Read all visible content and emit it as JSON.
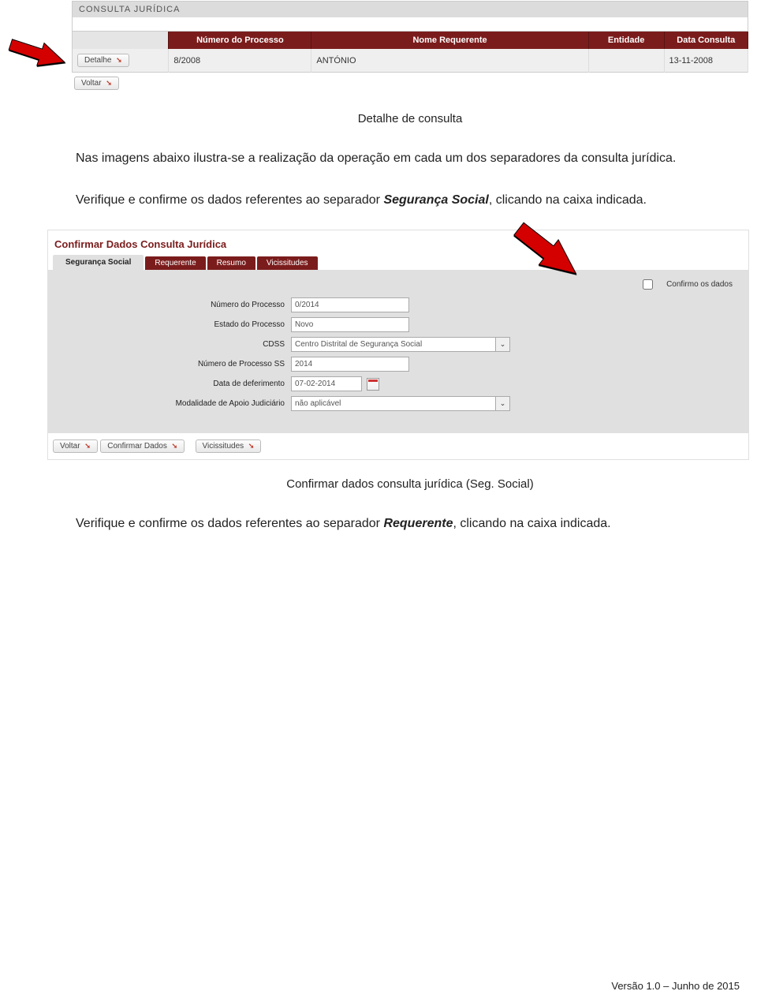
{
  "screenshot1": {
    "panel_title": "CONSULTA JURÍDICA",
    "columns": {
      "processo": "Número do Processo",
      "nome": "Nome Requerente",
      "entidade": "Entidade",
      "data": "Data Consulta"
    },
    "row": {
      "detalhe_btn": "Detalhe",
      "processo": "8/2008",
      "nome": "ANTÓNIO",
      "entidade": "",
      "data": "13-11-2008"
    },
    "voltar_btn": "Voltar"
  },
  "caption1": "Detalhe de consulta",
  "para1_a": "Nas imagens abaixo ilustra-se a realização da operação em cada um dos separadores da consulta jurídica.",
  "para2_a": "Verifique e confirme os dados referentes ao separador ",
  "para2_em": "Segurança Social",
  "para2_b": ", clicando na caixa indicada.",
  "screenshot2": {
    "heading": "Confirmar Dados Consulta Jurídica",
    "tabs": {
      "seg": "Segurança Social",
      "req": "Requerente",
      "res": "Resumo",
      "vic": "Vicissitudes"
    },
    "confirm_label": "Confirmo os dados",
    "fields": {
      "num_proc": {
        "label": "Número do Processo",
        "value": "0/2014"
      },
      "estado": {
        "label": "Estado do Processo",
        "value": "Novo"
      },
      "cdss": {
        "label": "CDSS",
        "value": "Centro Distrital de Segurança Social"
      },
      "num_ss": {
        "label": "Número de Processo SS",
        "value": "2014"
      },
      "data_def": {
        "label": "Data de deferimento",
        "value": "07-02-2014"
      },
      "modalidade": {
        "label": "Modalidade de Apoio Judiciário",
        "value": "não aplicável"
      }
    },
    "buttons": {
      "voltar": "Voltar",
      "confirmar": "Confirmar Dados",
      "vicissitudes": "Vicissitudes"
    }
  },
  "caption2": "Confirmar dados consulta jurídica (Seg. Social)",
  "para3_a": "Verifique e confirme os dados referentes ao separador ",
  "para3_em": "Requerente",
  "para3_b": ", clicando na caixa indicada.",
  "footer": "Versão 1.0 – Junho de 2015"
}
